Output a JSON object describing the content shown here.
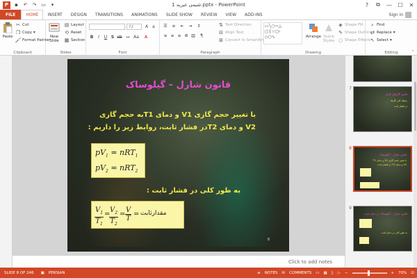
{
  "window": {
    "title": "شیمی غیریه 1.pptx - PowerPoint",
    "app_icon": "P",
    "controls": [
      "?",
      "⧉",
      "—",
      "☐",
      "✕"
    ]
  },
  "tabs": [
    "FILE",
    "HOME",
    "INSERT",
    "DESIGN",
    "TRANSITIONS",
    "ANIMATIONS",
    "SLIDE SHOW",
    "REVIEW",
    "VIEW",
    "ADD-INS"
  ],
  "active_tab": "HOME",
  "account": {
    "sign_in": "Sign in"
  },
  "ribbon": {
    "clipboard": {
      "label": "Clipboard",
      "paste": "Paste",
      "cut": "Cut",
      "copy": "Copy",
      "format_painter": "Format Painter"
    },
    "slides": {
      "label": "Slides",
      "new_slide": "New\nSlide",
      "layout": "Layout",
      "reset": "Reset",
      "section": "Section"
    },
    "font": {
      "label": "Font",
      "font_size": "72"
    },
    "paragraph": {
      "label": "Paragraph",
      "text_direction": "Text Direction",
      "align_text": "Align Text",
      "convert_smartart": "Convert to SmartArt"
    },
    "drawing": {
      "label": "Drawing",
      "arrange": "Arrange",
      "quick_styles": "Quick\nStyles",
      "shape_fill": "Shape Fill",
      "shape_outline": "Shape Outline",
      "shape_effects": "Shape Effects"
    },
    "editing": {
      "label": "Editing",
      "find": "Find",
      "replace": "Replace",
      "select": "Select"
    }
  },
  "slide": {
    "title": "قانون شارل – گیلوساک",
    "line1": "با تغییر حجم گازی V1 و دمای T1به حجم گازی",
    "line2": "V2 و دمای T2در فشار ثابت، روابط زیر را داریم :",
    "line4": "به طور کلی در فشار ثابت :",
    "eq1": {
      "lhs": "pV",
      "lsub": "1",
      "rhs": "= nRT",
      "rsub": "1"
    },
    "eq2": {
      "lhs": "pV",
      "lsub": "2",
      "rhs": "= nRT",
      "rsub": "2"
    },
    "eq3": {
      "f1_num": "V",
      "f1_num_sub": "1",
      "f1_den": "T",
      "f1_den_sub": "1",
      "f2_num": "V",
      "f2_num_sub": "2",
      "f2_den": "T",
      "f2_den_sub": "2",
      "f3_num": "V",
      "f3_den": "T",
      "eq": "=",
      "constant_word": "مقدارثابت"
    },
    "number": "8"
  },
  "notes_placeholder": "Click to add notes",
  "thumbnails": [
    {
      "num": "7",
      "title": "قانون گازهای کامل",
      "lines": [
        "رابطه کلی گازها",
        "در فشار ثابت"
      ]
    },
    {
      "num": "8",
      "title": "قانون شارل – گیلوساک",
      "lines": [
        "با تغییر حجم گازی V1 و دمای T1",
        "V2 و دمای T2 در فشار ثابت"
      ],
      "selected": true
    },
    {
      "num": "9",
      "title": "قانون شارل – گیلوساک در دمای ثابت",
      "lines": [
        "به طور کلی در دمای ثابت"
      ]
    }
  ],
  "status": {
    "slide_info": "SLIDE 8 OF 246",
    "language": "PERSIAN",
    "notes": "NOTES",
    "comments": "COMMENTS",
    "zoom": "70%"
  }
}
